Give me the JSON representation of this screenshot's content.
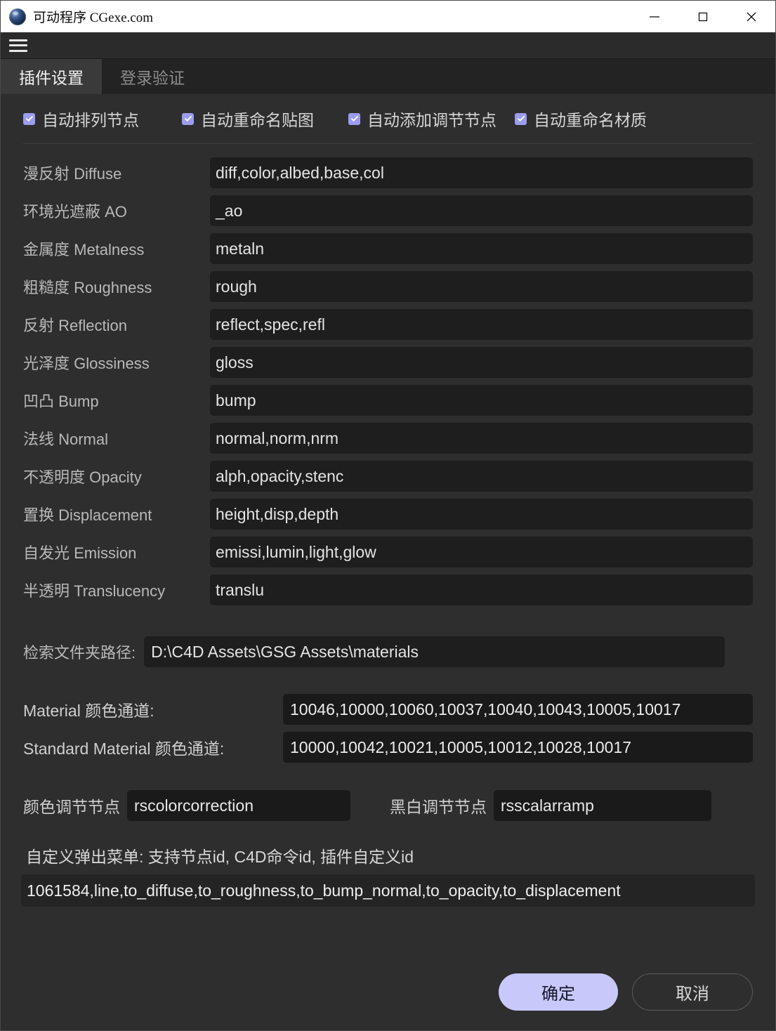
{
  "window": {
    "title": "可动程序 CGexe.com",
    "app_icon": "c4d-sphere-icon",
    "controls": {
      "minimize": "minimize-icon",
      "maximize": "maximize-icon",
      "close": "close-icon"
    }
  },
  "menu": {
    "hamburger": "hamburger-menu-icon"
  },
  "tabs": [
    {
      "label": "插件设置",
      "active": true
    },
    {
      "label": "登录验证",
      "active": false
    }
  ],
  "checkboxes": [
    {
      "label": "自动排列节点",
      "checked": true
    },
    {
      "label": "自动重命名贴图",
      "checked": true
    },
    {
      "label": "自动添加调节节点",
      "checked": true
    },
    {
      "label": "自动重命名材质",
      "checked": true
    }
  ],
  "channel_fields": [
    {
      "label": "漫反射 Diffuse",
      "value": "diff,color,albed,base,col"
    },
    {
      "label": "环境光遮蔽 AO",
      "value": "_ao"
    },
    {
      "label": "金属度 Metalness",
      "value": "metaln"
    },
    {
      "label": "粗糙度 Roughness",
      "value": "rough"
    },
    {
      "label": "反射 Reflection",
      "value": "reflect,spec,refl"
    },
    {
      "label": "光泽度 Glossiness",
      "value": "gloss"
    },
    {
      "label": "凹凸 Bump",
      "value": "bump"
    },
    {
      "label": "法线 Normal",
      "value": "normal,norm,nrm"
    },
    {
      "label": "不透明度 Opacity",
      "value": "alph,opacity,stenc"
    },
    {
      "label": "置换 Displacement",
      "value": "height,disp,depth"
    },
    {
      "label": "自发光 Emission",
      "value": "emissi,lumin,light,glow"
    },
    {
      "label": "半透明 Translucency",
      "value": "translu"
    }
  ],
  "search_path": {
    "label": "检索文件夹路径:",
    "value": "D:\\C4D Assets\\GSG Assets\\materials"
  },
  "material_channels": [
    {
      "label": "Material 颜色通道:",
      "value": "10046,10000,10060,10037,10040,10043,10005,10017"
    },
    {
      "label": "Standard Material 颜色通道:",
      "value": "10000,10042,10021,10005,10012,10028,10017"
    }
  ],
  "adjust_nodes": [
    {
      "label": "颜色调节节点",
      "value": "rscolorcorrection"
    },
    {
      "label": "黑白调节节点",
      "value": "rsscalarramp"
    }
  ],
  "custom_menu": {
    "title": "自定义弹出菜单: 支持节点id, C4D命令id, 插件自定义id",
    "value": "1061584,line,to_diffuse,to_roughness,to_bump_normal,to_opacity,to_displacement"
  },
  "buttons": {
    "ok": "确定",
    "cancel": "取消"
  },
  "colors": {
    "titlebar_bg": "#ffffff",
    "panel_bg": "#2e2e2e",
    "tabbar_bg": "#232323",
    "tab_active_bg": "#3a3a3a",
    "input_bg": "#1e1e1e",
    "checkbox_accent": "#9c9cf0",
    "ok_button_bg": "#c8c8fa",
    "label_text": "#b9b9b9",
    "value_text": "#e4e4e4"
  }
}
